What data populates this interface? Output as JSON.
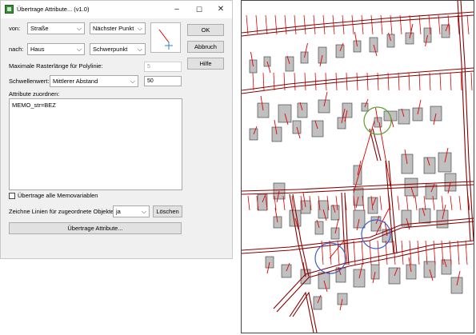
{
  "window": {
    "title": "Übertrage Attribute... (v1.0)",
    "minimize_glyph": "–",
    "maximize_glyph": "☐",
    "close_glyph": "✕"
  },
  "form": {
    "von_label": "von:",
    "von_layer": "Straße",
    "von_method": "Nächster Punkt",
    "nach_label": "nach:",
    "nach_layer": "Haus",
    "nach_method": "Schwerpunkt",
    "max_raster_label": "Maximale Rasterlänge für Polylinie:",
    "max_raster_value": "5",
    "schwellenwert_label": "Schwellenwert:",
    "schwellenwert_mode": "Mittlerer Abstand",
    "schwellenwert_value": "50",
    "attribute_label": "Attribute zuordnen:",
    "attribute_text": "MEMO_str=BEZ",
    "memo_checkbox_label": "Übertrage alle Memovariablen",
    "memo_checked": false,
    "zeichne_label": "Zeichne Linien für zugeordnete Objekte:",
    "zeichne_value": "ja"
  },
  "buttons": {
    "ok": "OK",
    "abbruch": "Abbruch",
    "hilfe": "Hilfe",
    "loeschen": "Löschen",
    "uebertrage": "Übertrage Attribute..."
  },
  "colors": {
    "dialog_bg": "#f0f0f0",
    "link_lines": "#e00000",
    "streets": "#8b0000",
    "buildings": "#c0c0c0",
    "highlight_green": "#5aa02c",
    "highlight_blue": "#3a5fcd"
  },
  "icons": {
    "direction_preview": "arrow-line-icon",
    "combo_arrow": "chevron-down-icon"
  }
}
